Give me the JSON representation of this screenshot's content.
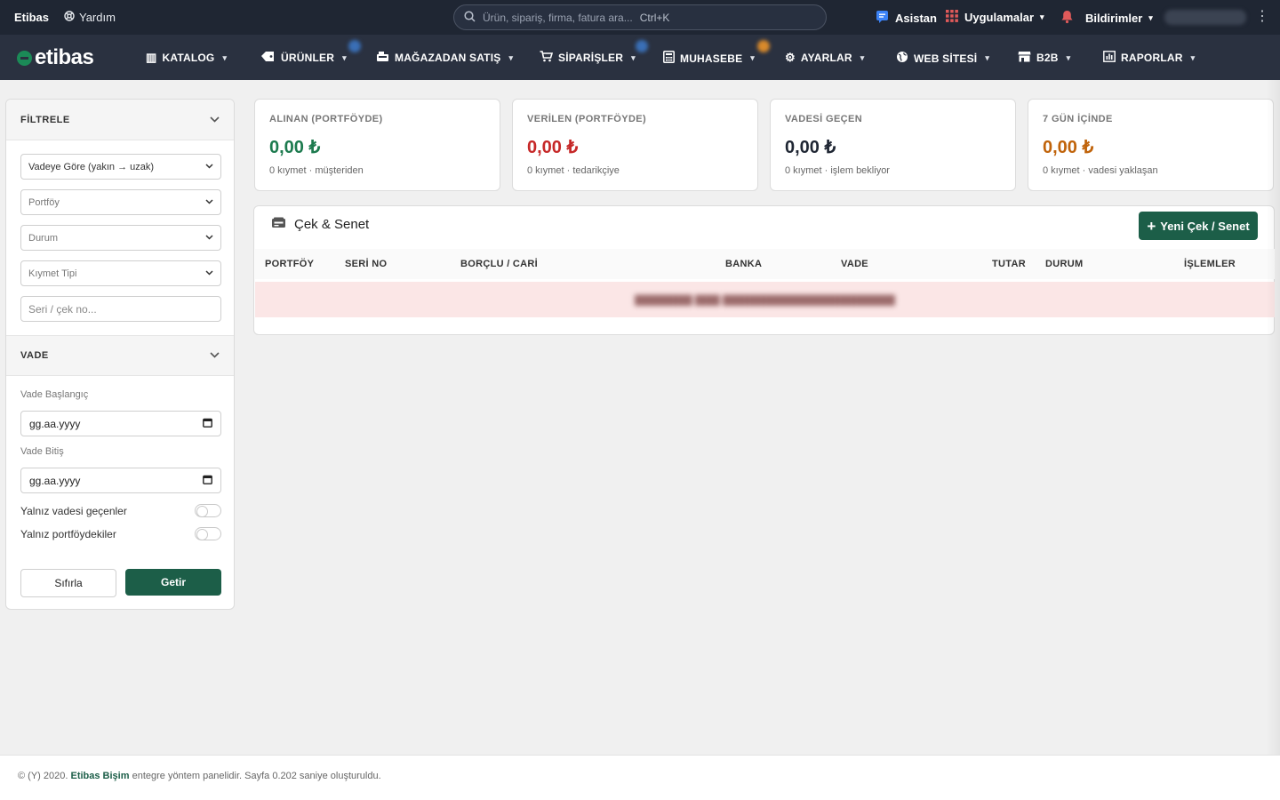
{
  "topbar": {
    "brand": "Etibas",
    "help_label": "Yardım",
    "search_placeholder": "Ürün, sipariş, firma, fatura ara...",
    "search_shortcut": "Ctrl+K",
    "assistant_label": "Asistan",
    "apps_label": "Uygulamalar",
    "notifications_label": "Bildirimler"
  },
  "nav": {
    "logo": "etibas",
    "items": [
      {
        "label": "KATALOG",
        "icon": "books-icon"
      },
      {
        "label": "ÜRÜNLER",
        "icon": "tag-icon"
      },
      {
        "label": "MAĞAZADAN SATIŞ",
        "icon": "cash-register-icon"
      },
      {
        "label": "SİPARİŞLER",
        "icon": "cart-icon"
      },
      {
        "label": "MUHASEBE",
        "icon": "calculator-icon"
      },
      {
        "label": "AYARLAR",
        "icon": "gear-icon"
      },
      {
        "label": "WEB SİTESİ",
        "icon": "globe-icon"
      },
      {
        "label": "B2B",
        "icon": "store-icon"
      },
      {
        "label": "RAPORLAR",
        "icon": "report-icon"
      }
    ]
  },
  "filter": {
    "title": "FİLTRELE",
    "sort_value": "Vadeye Göre (yakın → uzak)",
    "portfolio_placeholder": "Portföy",
    "status_placeholder": "Durum",
    "type_placeholder": "Kıymet Tipi",
    "serial_placeholder": "Seri / çek no...",
    "due_section_title": "VADE",
    "due_start_label": "Vade Başlangıç",
    "due_start_value": "gg.aa.yyyy",
    "due_end_label": "Vade Bitiş",
    "due_end_value": "gg.aa.yyyy",
    "only_overdue_label": "Yalnız vadesi geçenler",
    "only_portfolio_label": "Yalnız portföydekiler",
    "reset_label": "Sıfırla",
    "fetch_label": "Getir"
  },
  "stats": [
    {
      "title": "ALINAN (PORTFÖYDE)",
      "value": "0,00 ₺",
      "sub": "0 kıymet · müşteriden",
      "color": "#1c7a4e"
    },
    {
      "title": "VERİLEN (PORTFÖYDE)",
      "value": "0,00 ₺",
      "sub": "0 kıymet · tedarikçiye",
      "color": "#c62828"
    },
    {
      "title": "VADESİ GEÇEN",
      "value": "0,00 ₺",
      "sub": "0 kıymet · işlem bekliyor",
      "color": "#1f2633"
    },
    {
      "title": "7 GÜN İÇİNDE",
      "value": "0,00 ₺",
      "sub": "0 kıymet · vadesi yaklaşan",
      "color": "#c0630a"
    }
  ],
  "table": {
    "title": "Çek & Senet",
    "new_button": "Yeni Çek / Senet",
    "columns": [
      "PORTFÖY",
      "SERİ NO",
      "BORÇLU / CARİ",
      "BANKA",
      "VADE",
      "TUTAR",
      "DURUM",
      "İŞLEMLER"
    ]
  },
  "footer": {
    "prefix": "© (Y) 2020.",
    "brand": "Etibas Bişim",
    "suffix": "entegre yöntem panelidir. Sayfa 0.202 saniye oluşturuldu."
  }
}
